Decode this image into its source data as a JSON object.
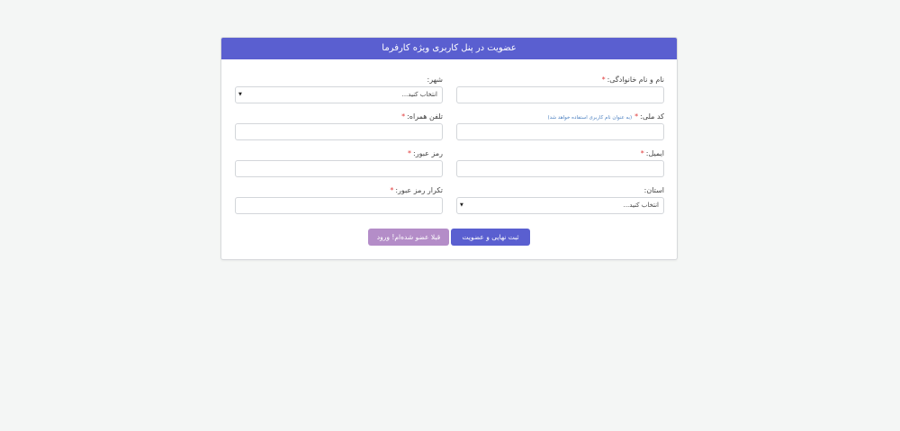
{
  "header": {
    "title": "عضویت در پنل کاربری ویژه کارفرما"
  },
  "fields": {
    "full_name": {
      "label": "نام و نام خانوادگی:",
      "required": "*"
    },
    "city": {
      "label": "شهر:",
      "selected": "انتخاب کنید..."
    },
    "national_code": {
      "label": "کد ملی:",
      "required": "*",
      "hint": "(به عنوان نام کاربری استفاده خواهد شد)"
    },
    "mobile": {
      "label": "تلفن همراه:",
      "required": "*"
    },
    "email": {
      "label": "ایمیل:",
      "required": "*"
    },
    "password": {
      "label": "رمز عبور:",
      "required": "*"
    },
    "province": {
      "label": "استان:",
      "selected": "انتخاب کنید..."
    },
    "password_repeat": {
      "label": "تکرار رمز عبور:",
      "required": "*"
    }
  },
  "buttons": {
    "submit": "ثبت نهایی و عضویت",
    "login": "قبلا عضو شده‌ام! ورود"
  },
  "colors": {
    "primary": "#5a5fd0",
    "secondary": "#b48dc8",
    "required": "#e03a3a",
    "background": "#f4f6f5"
  }
}
